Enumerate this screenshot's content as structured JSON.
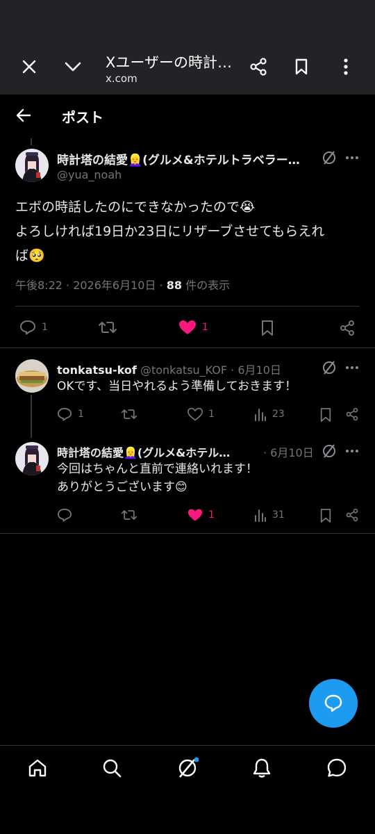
{
  "browser": {
    "title": "Xユーザーの時計塔の結愛",
    "url": "x.com"
  },
  "header": {
    "title": "ポスト"
  },
  "main_post": {
    "display_name": "時計塔の結愛👱‍♀️(グルメ&ホテルトラベラー…",
    "handle": "@yua_noah",
    "text_line1": "エボの時話したのにできなかったので😭",
    "text_line2": "よろしければ19日か23日にリザーブさせてもらえれ",
    "text_line3": "ば🥺",
    "timestamp": "午後8:22 · 2026年6月10日 · ",
    "views_count": "88",
    "views_label": " 件の表示",
    "replies": "1",
    "likes": "1"
  },
  "replies": [
    {
      "display_name": "tonkatsu-kof",
      "handle_date": "@tonkatsu_KOF · 6月10日",
      "text": "OKです、当日やれるよう準備しておきます！",
      "replies": "1",
      "likes": "1",
      "views": "23"
    },
    {
      "display_name": "時計塔の結愛👱‍♀️(グルメ&ホテル…",
      "date": "· 6月10日",
      "text_line1": "今回はちゃんと直前で連絡いれます！",
      "text_line2": "ありがとうございます😊",
      "likes": "1",
      "views": "31"
    }
  ],
  "colors": {
    "like": "#f91880",
    "accent": "#1d9bf0",
    "muted": "#71767b"
  }
}
